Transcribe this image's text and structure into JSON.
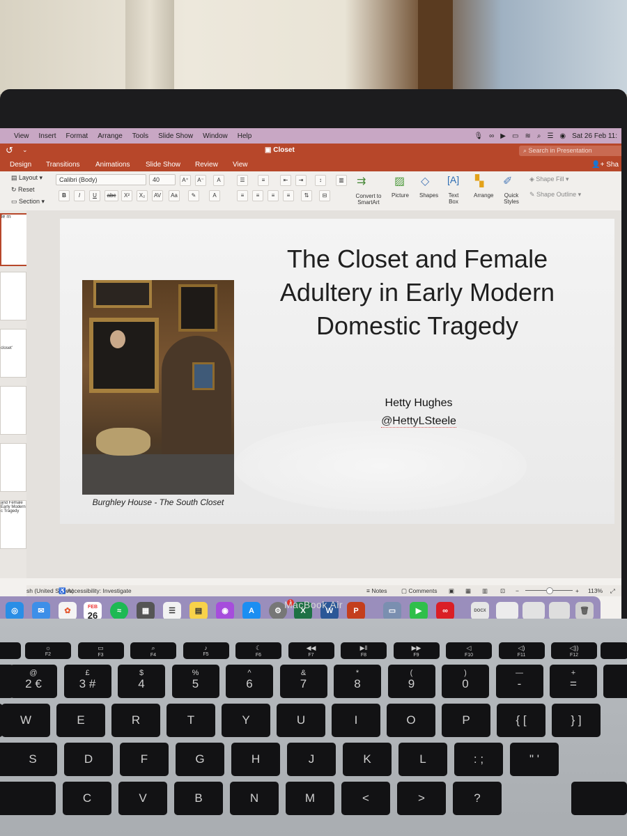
{
  "menubar": {
    "items": [
      "View",
      "Insert",
      "Format",
      "Arrange",
      "Tools",
      "Slide Show",
      "Window",
      "Help"
    ],
    "clock": "Sat 26 Feb  11:"
  },
  "titlebar": {
    "document_name": "Closet",
    "search_placeholder": "Search in Presentation"
  },
  "ribbon_tabs": {
    "items": [
      "Design",
      "Transitions",
      "Animations",
      "Slide Show",
      "Review",
      "View"
    ],
    "share": "Sha"
  },
  "ribbon": {
    "layout": "Layout",
    "reset": "Reset",
    "section": "Section",
    "font_name": "Calibri (Body)",
    "font_size": "40",
    "convert_smartart": "Convert to SmartArt",
    "picture": "Picture",
    "shapes": "Shapes",
    "text_box": "Text Box",
    "arrange": "Arrange",
    "quick_styles": "Quick Styles",
    "shape_fill": "Shape Fill",
    "shape_outline": "Shape Outline"
  },
  "thumbnails": {
    "t1": "le rn",
    "t3": "closet'",
    "t6": "and Female Early Modern c Tragedy"
  },
  "slide": {
    "title": "The Closet and Female Adultery in Early Modern Domestic Tragedy",
    "author": "Hetty Hughes",
    "handle": "@HettyLSteele",
    "caption": "Burghley House - The South Closet"
  },
  "statusbar": {
    "language": "sh (United States)",
    "accessibility": "Accessibility: Investigate",
    "notes": "Notes",
    "comments": "Comments",
    "zoom": "113%"
  },
  "dock": {
    "calendar_month": "FEB",
    "calendar_day": "26",
    "badge_count": "1",
    "docx_label": "DOCX"
  },
  "laptop": {
    "model": "MacBook Air"
  },
  "keyboard": {
    "fkeys": [
      {
        "fn": "F2",
        "icon": "☼"
      },
      {
        "fn": "F3",
        "icon": "▭"
      },
      {
        "fn": "F4",
        "icon": "⌕"
      },
      {
        "fn": "F5",
        "icon": "♪"
      },
      {
        "fn": "F6",
        "icon": "☾"
      },
      {
        "fn": "F7",
        "icon": "◀◀"
      },
      {
        "fn": "F8",
        "icon": "▶‖"
      },
      {
        "fn": "F9",
        "icon": "▶▶"
      },
      {
        "fn": "F10",
        "icon": "◁"
      },
      {
        "fn": "F11",
        "icon": "◁)"
      },
      {
        "fn": "F12",
        "icon": "◁))"
      }
    ],
    "numbers": [
      {
        "top": "@",
        "bot": "2 €"
      },
      {
        "top": "£",
        "bot": "3 #"
      },
      {
        "top": "$",
        "bot": "4"
      },
      {
        "top": "%",
        "bot": "5"
      },
      {
        "top": "^",
        "bot": "6"
      },
      {
        "top": "&",
        "bot": "7"
      },
      {
        "top": "*",
        "bot": "8"
      },
      {
        "top": "(",
        "bot": "9"
      },
      {
        "top": ")",
        "bot": "0"
      },
      {
        "top": "—",
        "bot": "-"
      },
      {
        "top": "+",
        "bot": "="
      }
    ],
    "row_qwerty": [
      "W",
      "E",
      "R",
      "T",
      "Y",
      "U",
      "I",
      "O",
      "P",
      "{ [",
      "} ]"
    ],
    "row_asdf": [
      "S",
      "D",
      "F",
      "G",
      "H",
      "J",
      "K",
      "L",
      ":  ;",
      "\"  '"
    ],
    "row_zxcv": [
      "C",
      "V",
      "B",
      "N",
      "M",
      "<",
      ">",
      "?"
    ]
  }
}
